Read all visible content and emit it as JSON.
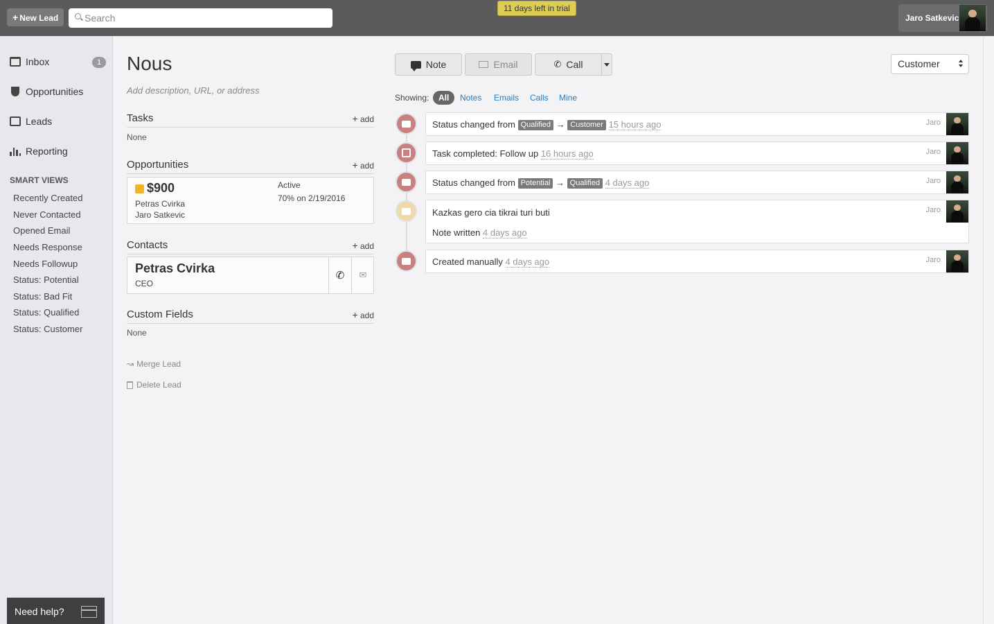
{
  "topbar": {
    "new_lead_label": "New Lead",
    "search_placeholder": "Search",
    "trial_text": "11 days left in trial",
    "user_name": "Jaro Satkevic"
  },
  "sidebar": {
    "items": [
      {
        "label": "Inbox",
        "icon": "inbox-icon",
        "badge": "1"
      },
      {
        "label": "Opportunities",
        "icon": "trophy-icon"
      },
      {
        "label": "Leads",
        "icon": "leads-icon"
      },
      {
        "label": "Reporting",
        "icon": "bar-chart-icon"
      }
    ],
    "smart_views_title": "SMART VIEWS",
    "smart_views": [
      "Recently Created",
      "Never Contacted",
      "Opened Email",
      "Needs Response",
      "Needs Followup",
      "Status: Potential",
      "Status: Bad Fit",
      "Status: Qualified",
      "Status: Customer"
    ],
    "help_label": "Need help?"
  },
  "lead": {
    "name": "Nous",
    "description_placeholder": "Add description, URL, or address",
    "tasks": {
      "title": "Tasks",
      "add": "add",
      "empty": "None"
    },
    "opportunities": {
      "title": "Opportunities",
      "add": "add",
      "items": [
        {
          "value": "$900",
          "contact": "Petras Cvirka",
          "owner": "Jaro Satkevic",
          "status": "Active",
          "confidence": "70% on 2/19/2016",
          "color": "#f0b429"
        }
      ]
    },
    "contacts": {
      "title": "Contacts",
      "add": "add",
      "items": [
        {
          "name": "Petras Cvirka",
          "title": "CEO"
        }
      ]
    },
    "custom_fields": {
      "title": "Custom Fields",
      "add": "add",
      "empty": "None"
    },
    "merge_label": "Merge Lead",
    "delete_label": "Delete Lead"
  },
  "actions": {
    "note_label": "Note",
    "email_label": "Email",
    "call_label": "Call",
    "status_value": "Customer"
  },
  "filters": {
    "showing_label": "Showing:",
    "options": [
      "All",
      "Notes",
      "Emails",
      "Calls",
      "Mine"
    ],
    "active": "All"
  },
  "activity": [
    {
      "prefix": "Status changed from",
      "from": "Qualified",
      "arrow": "→",
      "to": "Customer",
      "ago": "15 hours ago",
      "user": "Jaro"
    },
    {
      "prefix": "Task completed: Follow up",
      "ago": "16 hours ago",
      "user": "Jaro"
    },
    {
      "prefix": "Status changed from",
      "from": "Potential",
      "arrow": "→",
      "to": "Qualified",
      "ago": "4 days ago",
      "user": "Jaro"
    },
    {
      "note": "Kazkas gero cia tikrai turi buti",
      "sub": "Note written",
      "ago": "4 days ago",
      "user": "Jaro"
    },
    {
      "prefix": "Created manually",
      "ago": "4 days ago",
      "user": "Jaro"
    }
  ]
}
